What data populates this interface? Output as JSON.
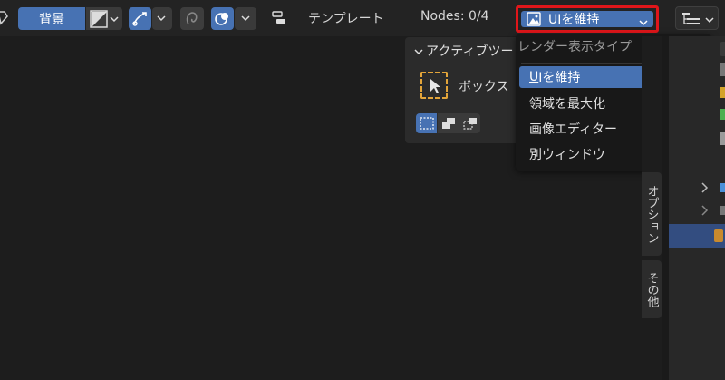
{
  "header": {
    "background_label": "背景",
    "template_label": "テンプレート",
    "nodes_label": "Nodes: 0/4",
    "display_mode_value": "UIを維持"
  },
  "tool_panel": {
    "title": "アクティブツー",
    "tool_name": "ボックス"
  },
  "render_menu": {
    "title": "レンダー表示タイプ",
    "items": [
      {
        "label_u": "U",
        "label_rest": "Iを維持",
        "selected": true
      },
      {
        "label": "領域を最大化",
        "selected": false
      },
      {
        "label": "画像エディター",
        "selected": false
      },
      {
        "label": "別ウィンドウ",
        "selected": false
      }
    ]
  },
  "sidebar_tabs": {
    "options": "オプション",
    "other": "その他"
  },
  "colors": {
    "accent": "#4772b3",
    "highlight_border": "#e0161a",
    "tool_dashed": "#e3a53a"
  }
}
